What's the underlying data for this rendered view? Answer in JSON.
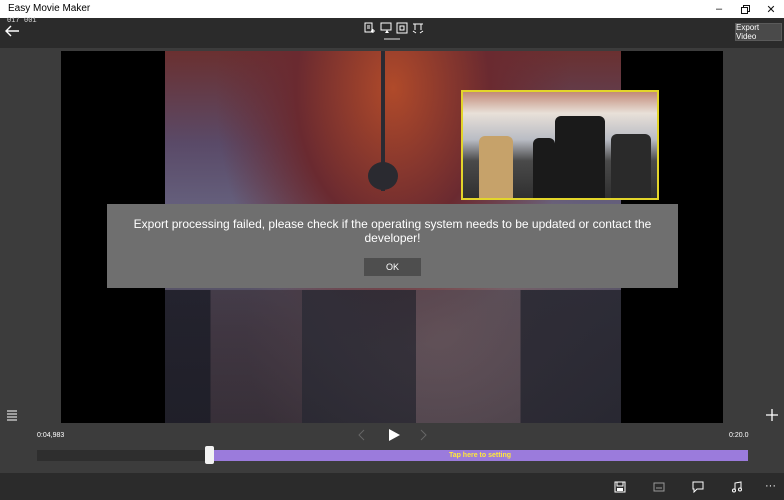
{
  "window": {
    "title": "Easy Movie Maker",
    "minimize_icon": "minimize-icon",
    "maximize_icon": "maximize-icon",
    "close_icon": "close-icon"
  },
  "debug": {
    "left": "017",
    "right": "001"
  },
  "toolbar": {
    "back_icon": "arrow-left-icon",
    "tools": [
      "add-media-icon",
      "pip-icon",
      "crop-icon",
      "effect-icon"
    ],
    "export_label": "Export Video"
  },
  "dialog": {
    "message": "Export processing failed, please check if the operating system needs to be updated or contact the developer!",
    "ok_label": "OK"
  },
  "playback": {
    "current_time": "0:04,983",
    "total_time": "0:20.0",
    "progress_fraction": 0.249
  },
  "timeline": {
    "hint": "Tap here to setting",
    "accent_color": "#9b7bdc",
    "hint_color": "#ffe83a"
  },
  "bottom_toolbar": [
    "save-icon",
    "subtitle-icon",
    "comment-icon",
    "music-icon",
    "more-icon"
  ],
  "colors": {
    "dialog_bg": "#6f6f6f",
    "pip_border": "#e3d52a"
  }
}
